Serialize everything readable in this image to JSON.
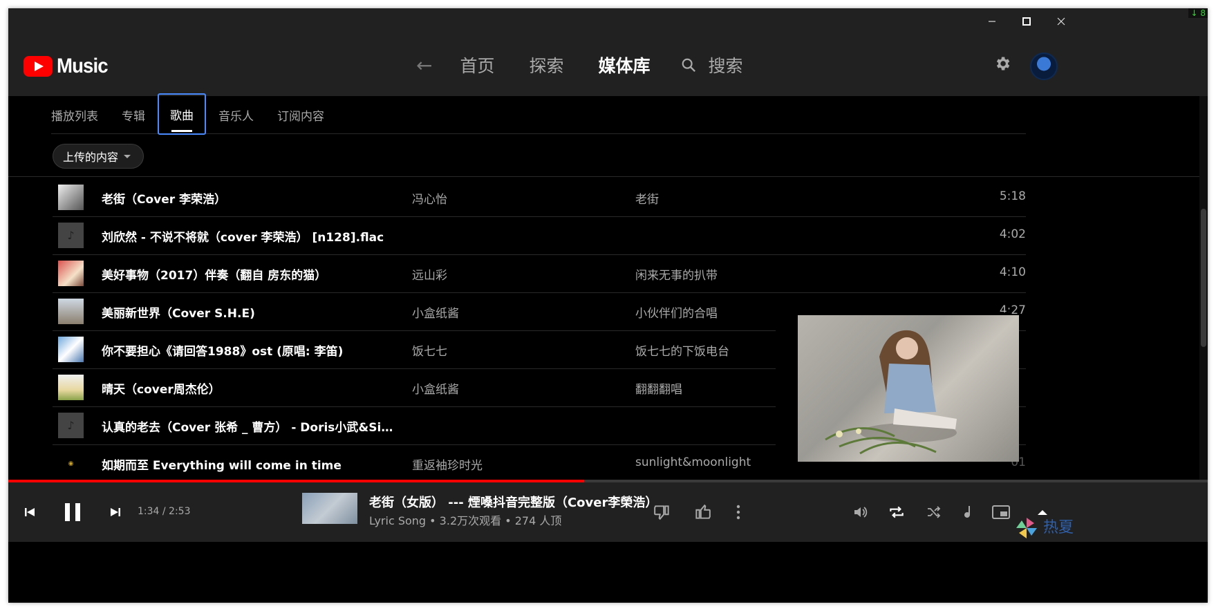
{
  "window": {
    "tray_badge": "↓ 8"
  },
  "nav": {
    "logo_text": "Music",
    "links": [
      "首页",
      "探索",
      "媒体库",
      "搜索"
    ]
  },
  "library_tabs": [
    "播放列表",
    "专辑",
    "歌曲",
    "音乐人",
    "订阅内容"
  ],
  "filter_chip": "上传的内容",
  "songs": [
    {
      "title": "老街（Cover 李荣浩）",
      "artist": "冯心怡",
      "album": "老街",
      "duration": "5:18"
    },
    {
      "title": "刘欣然 - 不说不将就（cover 李荣浩） [n128].flac",
      "artist": "",
      "album": "",
      "duration": "4:02"
    },
    {
      "title": "美好事物（2017）伴奏（翻自 房东的猫）",
      "artist": "远山彩",
      "album": "闲来无事的扒带",
      "duration": "4:10"
    },
    {
      "title": "美丽新世界（Cover S.H.E)",
      "artist": "小盒纸酱",
      "album": "小伙伴们的合唱",
      "duration": "4:27"
    },
    {
      "title": "你不要担心《请回答1988》ost (原唱: 李笛)",
      "artist": "饭七七",
      "album": "饭七七的下饭电台",
      "duration": ""
    },
    {
      "title": "晴天（cover周杰伦）",
      "artist": "小盒纸酱",
      "album": "翻翻翻唱",
      "duration": ""
    },
    {
      "title": "认真的老去（Cover 张希 _ 曹方） - Doris小武&Sis晴...",
      "artist": "",
      "album": "",
      "duration": ""
    },
    {
      "title": "如期而至 Everything will come in time",
      "artist": "重返袖珍时光",
      "album": "sunlight&moonlight",
      "duration": "6:01"
    }
  ],
  "player": {
    "time": "1:34 / 2:53",
    "progress": 0.48,
    "now_playing_title": "老街（女版） --- 煙嗓抖音完整版（Cover李榮浩）",
    "now_playing_sub": "Lyric Song • 3.2万次观看 • 274 人顶"
  },
  "watermark": "热夏",
  "colors": {
    "accent": "#ff0000",
    "bg": "#000000",
    "bar": "#212121",
    "focus": "#4a8cff"
  }
}
